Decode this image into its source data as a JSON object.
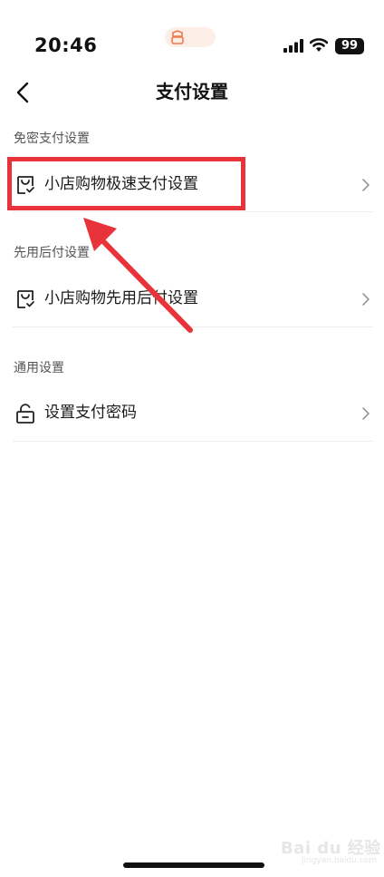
{
  "status_bar": {
    "time": "20:46",
    "battery": "99"
  },
  "nav": {
    "title": "支付设置"
  },
  "sections": [
    {
      "header": "免密支付设置",
      "items": [
        {
          "label": "小店购物极速支付设置",
          "icon": "shopping-bag-check-icon"
        }
      ]
    },
    {
      "header": "先用后付设置",
      "items": [
        {
          "label": "小店购物先用后付设置",
          "icon": "shopping-bag-check-icon"
        }
      ]
    },
    {
      "header": "通用设置",
      "items": [
        {
          "label": "设置支付密码",
          "icon": "lock-icon"
        }
      ]
    }
  ],
  "annotation": {
    "highlight_color": "#e8333a"
  },
  "watermark": {
    "brand": "Bai du 经验",
    "url": "jingyan.baidu.com"
  }
}
